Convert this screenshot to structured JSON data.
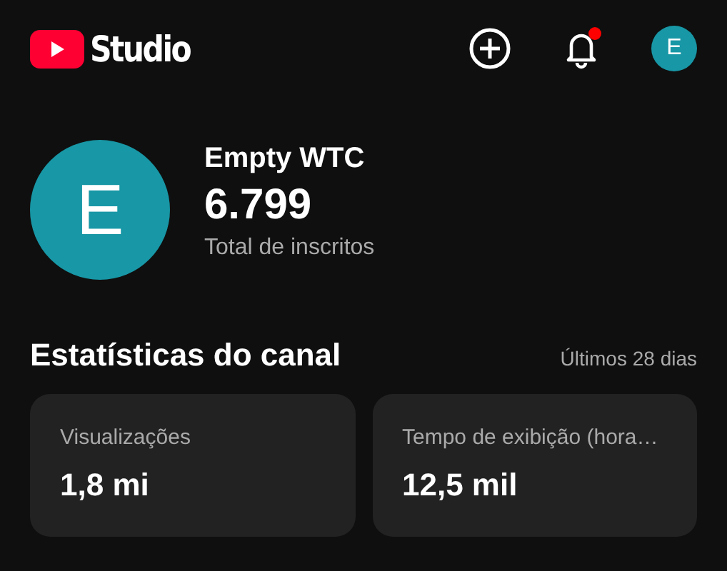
{
  "header": {
    "logo_text": "Studio",
    "notifications_unread": true,
    "avatar_letter": "E"
  },
  "channel": {
    "avatar_letter": "E",
    "name": "Empty WTC",
    "subscribers": "6.799",
    "subscribers_label": "Total de inscritos"
  },
  "stats": {
    "title": "Estatísticas do canal",
    "period": "Últimos 28 dias",
    "cards": [
      {
        "label": "Visualizações",
        "value": "1,8 mi"
      },
      {
        "label": "Tempo de exibição (hora…",
        "value": "12,5 mil"
      }
    ]
  }
}
